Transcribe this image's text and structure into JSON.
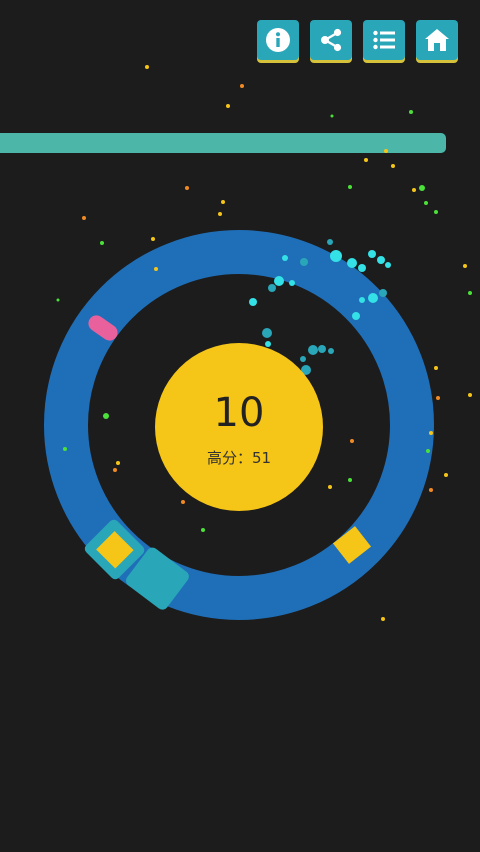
{
  "toolbar": {
    "buttons": [
      {
        "name": "info-button",
        "icon": "info-icon"
      },
      {
        "name": "share-button",
        "icon": "share-icon"
      },
      {
        "name": "menu-button",
        "icon": "list-icon"
      },
      {
        "name": "home-button",
        "icon": "home-icon"
      }
    ]
  },
  "hud": {
    "score": "10",
    "best_label": "高分",
    "best_separator": "：",
    "best_value": "51",
    "timer_fraction": 0.93
  },
  "colors": {
    "background": "#1c1c1c",
    "button": "#2aa6b9",
    "button_shadow": "#d6c23a",
    "ring": "#1f6fb8",
    "center": "#f5c518",
    "timer": "#4cb7a9",
    "target_segment": "#2aa6b9",
    "target_core": "#f5c518",
    "player_paddle": "#e8619c"
  }
}
